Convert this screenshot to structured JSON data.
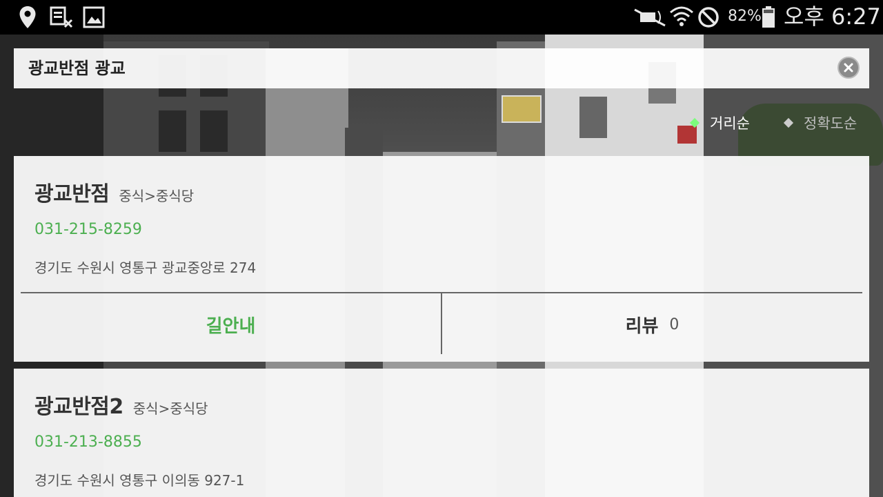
{
  "status_bar": {
    "battery_percent": "82%",
    "time": "오후 6:27",
    "icons": [
      "location-icon",
      "storage-icon",
      "gallery-icon",
      "mute-icon",
      "wifi-icon",
      "block-icon",
      "battery-icon"
    ]
  },
  "search": {
    "query": "광교반점 광교",
    "clear_icon": "close-icon"
  },
  "sort": {
    "options": [
      {
        "label": "거리순",
        "selected": true,
        "color": "#7CFC7C"
      },
      {
        "label": "정확도순",
        "selected": false,
        "color": "#bbbbbb"
      }
    ]
  },
  "results": [
    {
      "name": "광교반점",
      "category": "중식>중식당",
      "phone": "031-215-8259",
      "address": "경기도 수원시 영통구 광교중앙로 274",
      "actions": {
        "directions_label": "길안내",
        "review_label": "리뷰",
        "review_count": "0"
      }
    },
    {
      "name": "광교반점2",
      "category": "중식>중식당",
      "phone": "031-213-8855",
      "address": "경기도 수원시 영통구 이의동 927-1"
    }
  ],
  "colors": {
    "accent_green": "#4caf50",
    "status_bar": "#000000",
    "card_background": "#f8f8f8"
  }
}
